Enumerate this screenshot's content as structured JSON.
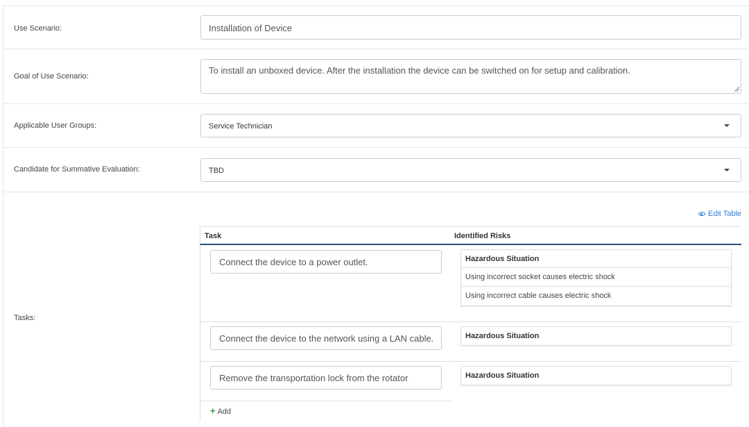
{
  "form": {
    "use_scenario": {
      "label": "Use Scenario:",
      "value": "Installation of Device"
    },
    "goal": {
      "label": "Goal of Use Scenario:",
      "value": "To install an unboxed device. After the installation the device can be switched on for setup and calibration."
    },
    "user_groups": {
      "label": "Applicable User Groups:",
      "value": "Service Technician"
    },
    "summative": {
      "label": "Candidate for Summative Evaluation:",
      "value": "TBD"
    },
    "tasks_label": "Tasks:"
  },
  "tasks_table": {
    "edit_label": "Edit Table",
    "col_task": "Task",
    "col_risks": "Identified Risks",
    "rows": [
      {
        "task": "Connect the device to a power outlet.",
        "risk_header": "Hazardous Situation",
        "risks": [
          "Using incorrect socket causes electric shock",
          "Using incorrect cable causes electric shock"
        ]
      },
      {
        "task": "Connect the device to the network using a LAN cable.",
        "risk_header": "Hazardous Situation",
        "risks": []
      },
      {
        "task": "Remove the transportation lock from the rotator",
        "risk_header": "Hazardous Situation",
        "risks": []
      }
    ],
    "add_label": "Add"
  },
  "colors": {
    "accent_link": "#2a7fd0",
    "header_border": "#2c4f7c",
    "add_plus": "#2e9e3e"
  }
}
